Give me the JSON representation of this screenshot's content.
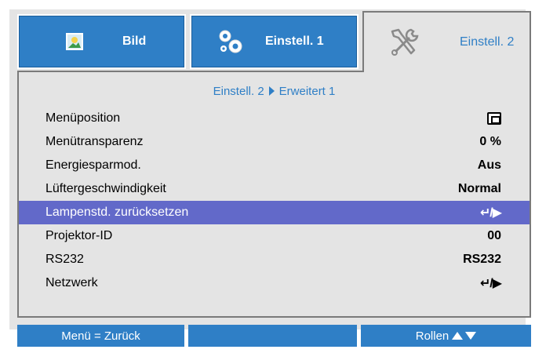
{
  "tabs": [
    {
      "label": "Bild",
      "icon": "picture-icon",
      "active": false
    },
    {
      "label": "Einstell. 1",
      "icon": "gears-icon",
      "active": false
    },
    {
      "label": "Einstell. 2",
      "icon": "tools-icon",
      "active": true
    }
  ],
  "breadcrumb": {
    "parent": "Einstell. 2",
    "child": "Erweitert 1"
  },
  "rows": [
    {
      "label": "Menüposition",
      "value": "",
      "icon": "menu-position-icon"
    },
    {
      "label": "Menütransparenz",
      "value": "0 %"
    },
    {
      "label": "Energiesparmod.",
      "value": "Aus"
    },
    {
      "label": "Lüftergeschwindigkeit",
      "value": "Normal"
    },
    {
      "label": "Lampenstd. zurücksetzen",
      "value": "↵/▶",
      "selected": true
    },
    {
      "label": "Projektor-ID",
      "value": "00"
    },
    {
      "label": "RS232",
      "value": "RS232"
    },
    {
      "label": "Netzwerk",
      "value": "↵/▶"
    }
  ],
  "footer": {
    "back": "Menü = Zurück",
    "middle": "",
    "scroll": "Rollen"
  },
  "colors": {
    "accent": "#2f7fc6",
    "selected": "#6269c9",
    "panel": "#e4e4e4"
  }
}
